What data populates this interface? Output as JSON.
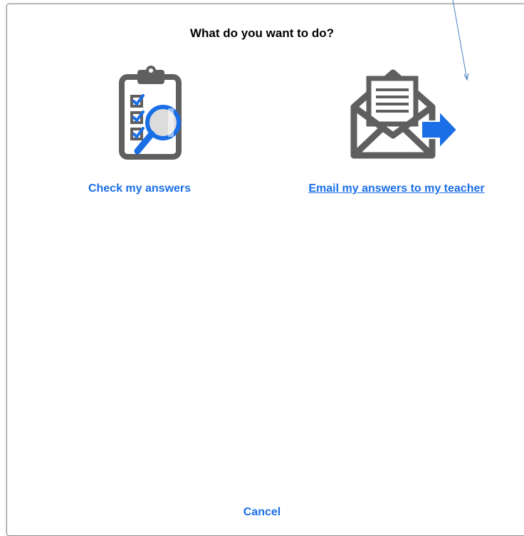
{
  "dialog": {
    "title": "What do you want to do?",
    "options": [
      {
        "label": "Check my answers",
        "icon": "clipboard-magnifier-icon"
      },
      {
        "label": "Email my answers to my teacher",
        "icon": "envelope-send-icon"
      }
    ],
    "cancel_label": "Cancel"
  },
  "colors": {
    "link": "#1a6ee6",
    "icon_gray": "#5f5f5f",
    "icon_blue": "#1a6ee6"
  }
}
